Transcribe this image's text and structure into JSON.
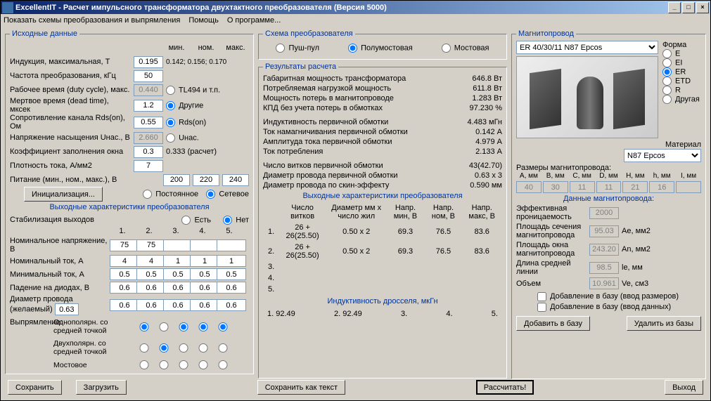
{
  "title": "ExcellentIT - Расчет импульсного трансформатора двухтактного преобразователя (Версия 5000)",
  "menu": {
    "schemes": "Показать схемы преобразования и выпрямления",
    "help": "Помощь",
    "about": "О программе..."
  },
  "input": {
    "legend": "Исходные данные",
    "minmax": {
      "min": "мин.",
      "nom": "ном.",
      "max": "макс."
    },
    "induction": {
      "label": "Индукция, максимальная, Т",
      "v": "0.195",
      "min": "0.142;",
      "nom": "0.156;",
      "max": "0.170"
    },
    "freq": {
      "label": "Частота преобразования, кГц",
      "v": "50"
    },
    "duty": {
      "label": "Рабочее время (duty cycle), макс.",
      "v": "0.440",
      "opt": "TL494 и т.п."
    },
    "dead": {
      "label": "Мертвое время (dead time), мксек",
      "v": "1.2",
      "opt": "Другие"
    },
    "rds": {
      "label": "Сопротивление канала Rds(on), Ом",
      "v": "0.55",
      "opt": "Rds(on)"
    },
    "usat": {
      "label": "Напряжение насыщения Uнас., В",
      "v": "2.660",
      "opt": "Uнас."
    },
    "kfill": {
      "label": "Коэффициент заполнения окна",
      "v": "0.3",
      "calc": "0.333 (расчет)"
    },
    "jdens": {
      "label": "Плотность тока, А/мм2",
      "v": "7"
    },
    "supply": {
      "label": "Питание (мин., ном., макс.), В",
      "min": "200",
      "nom": "220",
      "max": "240"
    },
    "initbtn": "Инициализация...",
    "ptype": {
      "const": "Постоянное",
      "mains": "Сетевое"
    },
    "outlegend": "Выходные характеристики преобразователя",
    "stab": {
      "label": "Стабилизация выходов",
      "yes": "Есть",
      "no": "Нет"
    },
    "cols": [
      "1.",
      "2.",
      "3.",
      "4.",
      "5."
    ],
    "unom": {
      "label": "Номинальное напряжение, В",
      "v": [
        "75",
        "75",
        "",
        "",
        ""
      ]
    },
    "inom": {
      "label": "Номинальный ток, А",
      "v": [
        "4",
        "4",
        "1",
        "1",
        "1"
      ]
    },
    "imin": {
      "label": "Минимальный ток, А",
      "v": [
        "0.5",
        "0.5",
        "0.5",
        "0.5",
        "0.5"
      ]
    },
    "vdrop": {
      "label": "Падение на диодах, В",
      "v": [
        "0.6",
        "0.6",
        "0.6",
        "0.6",
        "0.6"
      ]
    },
    "wdia": {
      "label": "Диаметр провода (желаемый)",
      "v0": "0.63",
      "v": [
        "0.6",
        "0.6",
        "0.6",
        "0.6",
        "0.6"
      ]
    },
    "rectlbl": "Выпрямление:",
    "rectopts": [
      "Однополярн. со средней точкой",
      "Двухполярн. со средней точкой",
      "Мостовое"
    ]
  },
  "scheme": {
    "legend": "Схема преобразователя",
    "push": "Пуш-пул",
    "half": "Полумостовая",
    "full": "Мостовая"
  },
  "results": {
    "legend": "Результаты расчета",
    "rows": [
      {
        "l": "Габаритная мощность трансформатора",
        "v": "646.8 Вт"
      },
      {
        "l": "Потребляемая нагрузкой мощность",
        "v": "611.8 Вт"
      },
      {
        "l": "Мощность потерь в магнитопроводе",
        "v": "1.283 Вт"
      },
      {
        "l": "КПД без учета потерь в обмотках",
        "v": "97.230 %"
      }
    ],
    "rows2": [
      {
        "l": "Индуктивность первичной обмотки",
        "v": "4.483 мГн"
      },
      {
        "l": "Ток намагничивания первичной обмотки",
        "v": "0.142 А"
      },
      {
        "l": "Амплитуда тока первичной обмотки",
        "v": "4.979 А"
      },
      {
        "l": "Ток потребления",
        "v": "2.133 А"
      }
    ],
    "rows3": [
      {
        "l": "Число витков первичной обмотки",
        "v": "43(42.70)"
      },
      {
        "l": "Диаметр провода первичной обмотки",
        "v": "0.63 x 3"
      },
      {
        "l": "Диаметр провода по скин-эффекту",
        "v": "0.590 мм"
      }
    ],
    "outhdr": "Выходные характеристики преобразователя",
    "outcols": [
      "",
      "Число витков",
      "Диаметр мм х число жил",
      "Напр. мин, В",
      "Напр. ном, В",
      "Напр. макс, В"
    ],
    "outdata": [
      [
        "1.",
        "26 + 26(25.50)",
        "0.50 x 2",
        "69.3",
        "76.5",
        "83.6"
      ],
      [
        "2.",
        "26 + 26(25.50)",
        "0.50 x 2",
        "69.3",
        "76.5",
        "83.6"
      ],
      [
        "3.",
        "",
        "",
        "",
        "",
        ""
      ],
      [
        "4.",
        "",
        "",
        "",
        "",
        ""
      ],
      [
        "5.",
        "",
        "",
        "",
        "",
        ""
      ]
    ],
    "lhdr": "Индуктивность дросселя, мкГн",
    "lrow": [
      "1. 92.49",
      "2. 92.49",
      "3.",
      "4.",
      "5."
    ]
  },
  "core": {
    "legend": "Магнитопровод",
    "sel": "ER 40/30/11 N87 Epcos",
    "formlbl": "Форма",
    "forms": [
      "E",
      "EI",
      "ER",
      "ETD",
      "R",
      "Другая"
    ],
    "matlbl": "Материал",
    "mat": "N87 Epcos",
    "dimlbl": "Размеры магнитопровода:",
    "dimhdr": [
      "A, мм",
      "B, мм",
      "C, мм",
      "D, мм",
      "H, мм",
      "h, мм",
      "I, мм"
    ],
    "dims": [
      "40",
      "30",
      "11",
      "11",
      "21",
      "16",
      ""
    ],
    "datalbl": "Данные магнитопровода:",
    "eff": {
      "l": "Эффективная проницаемость",
      "v": "2000",
      "u": ""
    },
    "ae": {
      "l": "Площадь сечения магнитопровода",
      "v": "95.03",
      "u": "Ae, мм2"
    },
    "an": {
      "l": "Площадь окна магнитопровода",
      "v": "243.20",
      "u": "An, мм2"
    },
    "le": {
      "l": "Длина средней линии",
      "v": "98.5",
      "u": "le, мм"
    },
    "ve": {
      "l": "Объем",
      "v": "10.961",
      "u": "Ve, см3"
    },
    "add1": "Добавление в базу (ввод размеров)",
    "add2": "Добавление в базу (ввод данных)",
    "addbtn": "Добавить в базу",
    "delbtn": "Удалить из базы"
  },
  "bottom": {
    "save": "Сохранить",
    "load": "Загрузить",
    "savetxt": "Сохранить как текст",
    "calc": "Рассчитать!",
    "exit": "Выход"
  }
}
